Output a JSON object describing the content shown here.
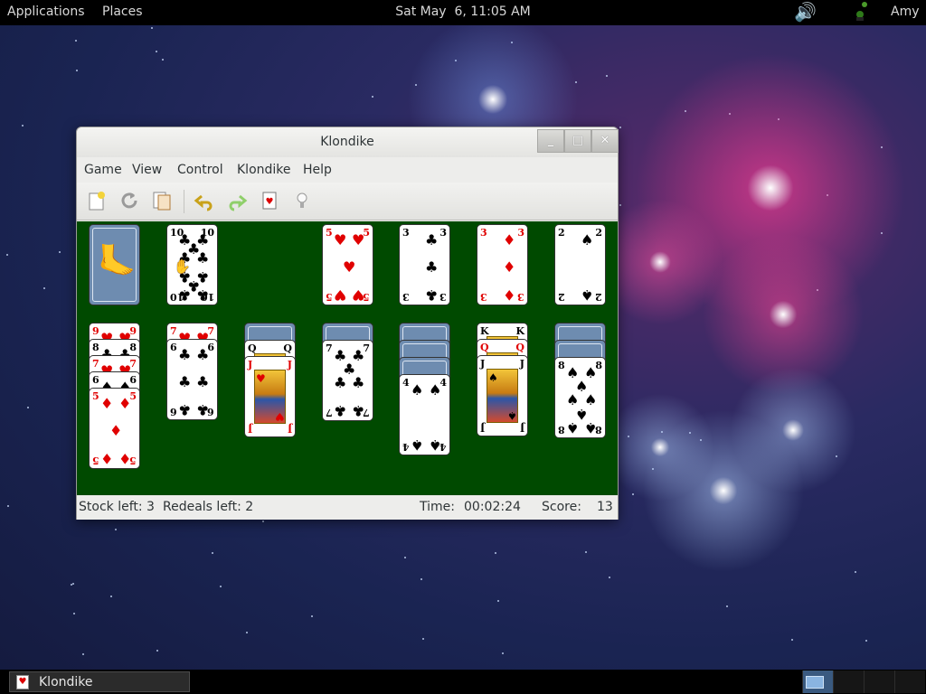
{
  "top_panel": {
    "applications": "Applications",
    "places": "Places",
    "clock": "Sat May  6, 11:05 AM",
    "volume_icon": "volume-icon",
    "network_icon": "network-icon",
    "user": "Amy"
  },
  "window": {
    "title": "Klondike",
    "controls": {
      "minimize": "_",
      "maximize": "□",
      "close": "✕"
    },
    "menu": [
      "Game",
      "View",
      "Control",
      "Klondike",
      "Help"
    ],
    "toolbar": [
      "new-game-icon",
      "restart-icon",
      "select-game-icon",
      "undo-icon",
      "redo-icon",
      "deal-icon",
      "hint-icon"
    ],
    "colors": {
      "felt": "#004a00",
      "card_back": "#6e8cb0",
      "red_suit": "#e00000"
    },
    "board": {
      "stock": {
        "face_down": true
      },
      "waste": [
        {
          "rank": "10",
          "suit": "♣",
          "color": "black"
        }
      ],
      "foundations": [
        {
          "rank": "5",
          "suit": "♥",
          "color": "red"
        },
        {
          "rank": "3",
          "suit": "♣",
          "color": "black"
        },
        {
          "rank": "3",
          "suit": "♦",
          "color": "red"
        },
        {
          "rank": "2",
          "suit": "♠",
          "color": "black"
        }
      ],
      "tableau": [
        {
          "hidden": 0,
          "cards": [
            {
              "rank": "9",
              "suit": "♥",
              "color": "red"
            },
            {
              "rank": "8",
              "suit": "♣",
              "color": "black"
            },
            {
              "rank": "7",
              "suit": "♥",
              "color": "red"
            },
            {
              "rank": "6",
              "suit": "♠",
              "color": "black"
            },
            {
              "rank": "5",
              "suit": "♦",
              "color": "red"
            }
          ]
        },
        {
          "hidden": 0,
          "cards": [
            {
              "rank": "7",
              "suit": "♥",
              "color": "red"
            },
            {
              "rank": "6",
              "suit": "♣",
              "color": "black"
            }
          ]
        },
        {
          "hidden": 1,
          "cards": [
            {
              "rank": "Q",
              "suit": "♠",
              "color": "black"
            },
            {
              "rank": "J",
              "suit": "♥",
              "color": "red"
            }
          ]
        },
        {
          "hidden": 1,
          "cards": [
            {
              "rank": "7",
              "suit": "♣",
              "color": "black"
            }
          ]
        },
        {
          "hidden": 3,
          "cards": [
            {
              "rank": "4",
              "suit": "♠",
              "color": "black"
            }
          ]
        },
        {
          "hidden": 0,
          "cards": [
            {
              "rank": "K",
              "suit": "♠",
              "color": "black"
            },
            {
              "rank": "Q",
              "suit": "♥",
              "color": "red"
            },
            {
              "rank": "J",
              "suit": "♠",
              "color": "black"
            }
          ]
        },
        {
          "hidden": 2,
          "cards": [
            {
              "rank": "8",
              "suit": "♠",
              "color": "black"
            }
          ]
        }
      ]
    },
    "status": {
      "stock_left": "Stock left: 3",
      "redeals_left": "Redeals left: 2",
      "time_label": "Time:",
      "time_value": "00:02:24",
      "score_label": "Score:",
      "score_value": "13"
    }
  },
  "bottom_panel": {
    "task_label": "Klondike",
    "task_icon": "klondike-app-icon"
  }
}
